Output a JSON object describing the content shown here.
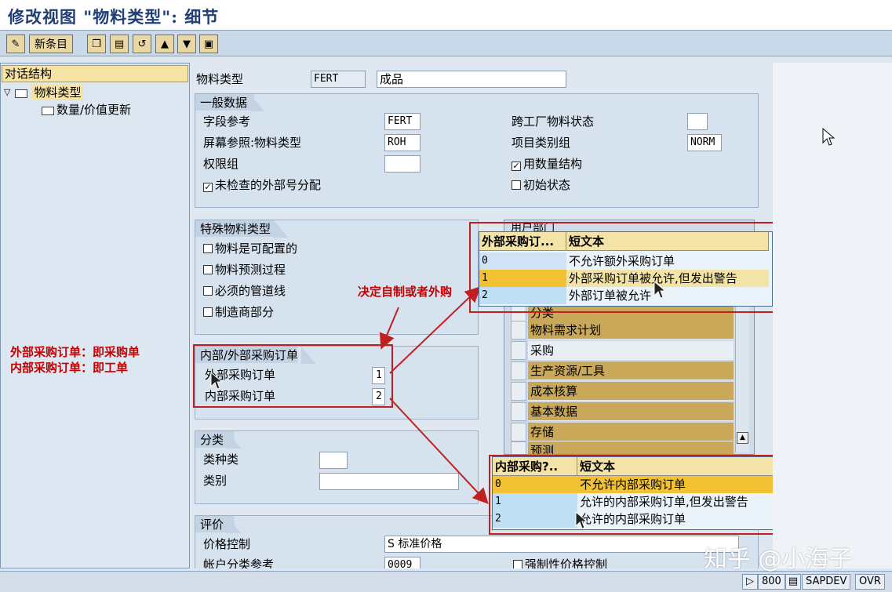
{
  "window": {
    "title": "修改视图 \"物料类型\": 细节"
  },
  "toolbar": {
    "new_entries": "新条目"
  },
  "left_panel": {
    "header": "对话结构",
    "tree": [
      {
        "label": "物料类型"
      },
      {
        "label": "数量/价值更新"
      }
    ],
    "notes": [
      "外部采购订单：即采购单",
      "内部采购订单：即工单"
    ]
  },
  "header_fields": {
    "material_type_label": "物料类型",
    "material_type_value": "FERT",
    "description_value": "成品"
  },
  "general_data": {
    "title": "一般数据",
    "field_ref_label": "字段参考",
    "field_ref_value": "FERT",
    "screen_ref_label": "屏幕参照:物料类型",
    "screen_ref_value": "ROH",
    "auth_group_label": "权限组",
    "unchecked_ext_no_label": "未检查的外部号分配",
    "cross_plant_status_label": "跨工厂物料状态",
    "item_cat_group_label": "项目类别组",
    "item_cat_group_value": "NORM",
    "with_qty_structure_label": "用数量结构",
    "initial_status_label": "初始状态"
  },
  "special_material": {
    "title": "特殊物料类型",
    "items": [
      "物料是可配置的",
      "物料预测过程",
      "必须的管道线",
      "制造商部分"
    ]
  },
  "procurement": {
    "title": "内部/外部采购订单",
    "external_label": "外部采购订单",
    "external_value": "1",
    "internal_label": "内部采购订单",
    "internal_value": "2"
  },
  "classification": {
    "title": "分类",
    "class_type_label": "类种类",
    "class_label": "类别"
  },
  "valuation": {
    "title": "评价",
    "price_control_label": "价格控制",
    "price_control_value": "S 标准价格",
    "acct_cat_ref_label": "帐户分类参考",
    "acct_cat_ref_value": "0009",
    "forced_price_label": "强制性价格控制"
  },
  "user_departments": {
    "title": "用户部门",
    "items": [
      "分类",
      "物料需求计划",
      "采购",
      "生产资源/工具",
      "成本核算",
      "基本数据",
      "存储",
      "预测"
    ]
  },
  "annotation": {
    "text": "决定自制或者外购"
  },
  "popup_external": {
    "col1": "外部采购订...",
    "col2": "短文本",
    "rows": [
      {
        "key": "0",
        "text": "不允许额外采购订单"
      },
      {
        "key": "1",
        "text": "外部采购订单被允许,但发出警告"
      },
      {
        "key": "2",
        "text": "外部订单被允许"
      }
    ]
  },
  "popup_internal": {
    "col1": "内部采购?..",
    "col2": "短文本",
    "rows": [
      {
        "key": "0",
        "text": "不允许内部采购订单"
      },
      {
        "key": "1",
        "text": "允许的内部采购订单,但发出警告"
      },
      {
        "key": "2",
        "text": "允许的内部采购订单"
      }
    ]
  },
  "status_bar": {
    "client": "800",
    "system": "SAPDEV",
    "mode": "OVR"
  },
  "watermark": {
    "text": "知乎 @小海子"
  }
}
